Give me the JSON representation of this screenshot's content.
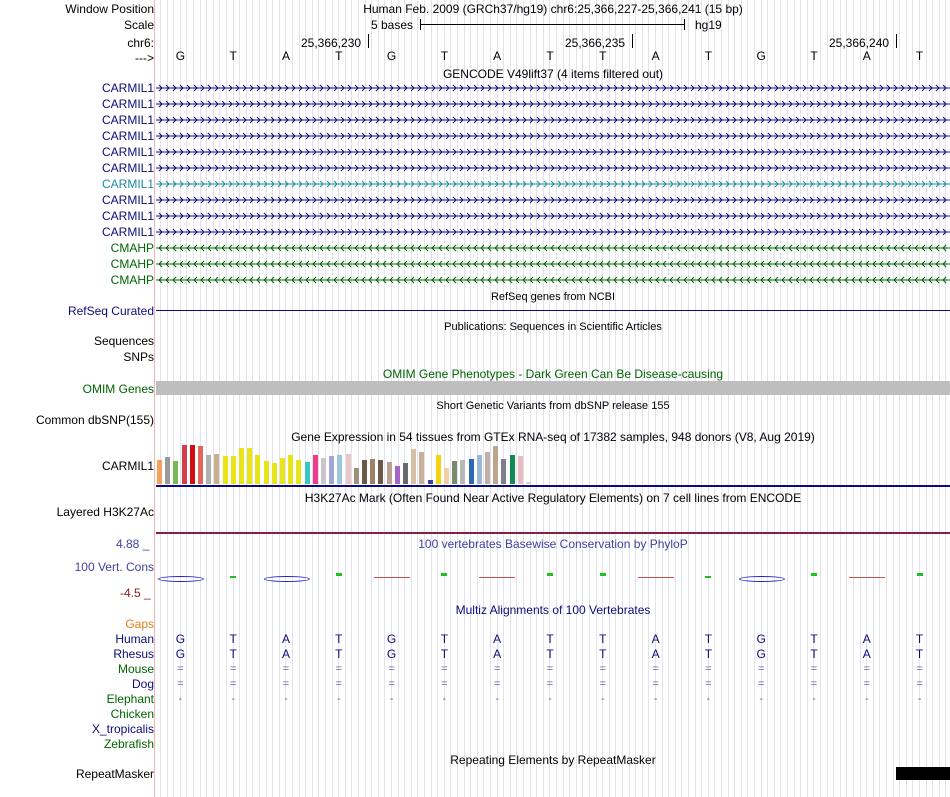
{
  "header": {
    "position_label": "Window Position",
    "position_value": "Human Feb. 2009 (GRCh37/hg19)   chr6:25,366,227-25,366,241 (15 bp)",
    "scale_label": "Scale",
    "scale_text": "5 bases",
    "scale_assembly": "hg19",
    "chrom_label": "chr6:",
    "coords": [
      "25,366,230",
      "25,366,235",
      "25,366,240"
    ],
    "strand_label": "--->",
    "bases": [
      "G",
      "T",
      "A",
      "T",
      "G",
      "T",
      "A",
      "T",
      "T",
      "A",
      "T",
      "G",
      "T",
      "A",
      "T"
    ]
  },
  "gencode": {
    "title": "GENCODE V49lift37 (4 items filtered out)",
    "genes": [
      {
        "label": "CARMIL1",
        "color": "#0c0c78",
        "strand": "+"
      },
      {
        "label": "CARMIL1",
        "color": "#0c0c78",
        "strand": "+"
      },
      {
        "label": "CARMIL1",
        "color": "#0c0c78",
        "strand": "+"
      },
      {
        "label": "CARMIL1",
        "color": "#0c0c78",
        "strand": "+"
      },
      {
        "label": "CARMIL1",
        "color": "#0c0c78",
        "strand": "+"
      },
      {
        "label": "CARMIL1",
        "color": "#0c0c78",
        "strand": "+"
      },
      {
        "label": "CARMIL1",
        "color": "#1a8ca0",
        "strand": "+"
      },
      {
        "label": "CARMIL1",
        "color": "#0c0c78",
        "strand": "+"
      },
      {
        "label": "CARMIL1",
        "color": "#0c0c78",
        "strand": "+"
      },
      {
        "label": "CARMIL1",
        "color": "#0c0c78",
        "strand": "+"
      },
      {
        "label": "CMAHP",
        "color": "#006400",
        "strand": "-"
      },
      {
        "label": "CMAHP",
        "color": "#006400",
        "strand": "-"
      },
      {
        "label": "CMAHP",
        "color": "#006400",
        "strand": "-"
      }
    ]
  },
  "refseq": {
    "title": "RefSeq genes from NCBI",
    "label": "RefSeq Curated"
  },
  "publications": {
    "title": "Publications: Sequences in Scientific Articles",
    "label1": "Sequences",
    "label2": "SNPs"
  },
  "omim": {
    "title": "OMIM Gene Phenotypes - Dark Green Can Be Disease-causing",
    "label": "OMIM Genes"
  },
  "dbsnp": {
    "title": "Short Genetic Variants from dbSNP release 155",
    "label": "Common dbSNP(155)"
  },
  "gtex": {
    "title": "Gene Expression in 54 tissues from GTEx RNA-seq of 17382 samples, 948 donors (V8, Aug 2019)",
    "label": "CARMIL1",
    "bars": [
      {
        "v": 0.6,
        "c": "#f2a25b"
      },
      {
        "v": 0.68,
        "c": "#9a9a9a"
      },
      {
        "v": 0.58,
        "c": "#7ab85a"
      },
      {
        "v": 0.98,
        "c": "#d23f4b"
      },
      {
        "v": 0.98,
        "c": "#d01010"
      },
      {
        "v": 0.96,
        "c": "#e0685c"
      },
      {
        "v": 0.72,
        "c": "#b0b0b0"
      },
      {
        "v": 0.74,
        "c": "#c8b08c"
      },
      {
        "v": 0.7,
        "c": "#e9e41a"
      },
      {
        "v": 0.7,
        "c": "#e9e41a"
      },
      {
        "v": 0.9,
        "c": "#e9e41a"
      },
      {
        "v": 0.9,
        "c": "#e9e41a"
      },
      {
        "v": 0.72,
        "c": "#e9e41a"
      },
      {
        "v": 0.58,
        "c": "#e9e41a"
      },
      {
        "v": 0.52,
        "c": "#e9e41a"
      },
      {
        "v": 0.64,
        "c": "#e9e41a"
      },
      {
        "v": 0.72,
        "c": "#e9e41a"
      },
      {
        "v": 0.6,
        "c": "#e9e41a"
      },
      {
        "v": 0.55,
        "c": "#3cc3c8"
      },
      {
        "v": 0.72,
        "c": "#ef3c8b"
      },
      {
        "v": 0.66,
        "c": "#c8c8c8"
      },
      {
        "v": 0.7,
        "c": "#a0a8d8"
      },
      {
        "v": 0.72,
        "c": "#9ec6e0"
      },
      {
        "v": 0.74,
        "c": "#ebc8c8"
      },
      {
        "v": 0.4,
        "c": "#a09078"
      },
      {
        "v": 0.6,
        "c": "#6a5a4a"
      },
      {
        "v": 0.62,
        "c": "#a08060"
      },
      {
        "v": 0.6,
        "c": "#6c5a46"
      },
      {
        "v": 0.56,
        "c": "#bea090"
      },
      {
        "v": 0.46,
        "c": "#a565c8"
      },
      {
        "v": 0.52,
        "c": "#6a6a6a"
      },
      {
        "v": 0.88,
        "c": "#d6c0a8"
      },
      {
        "v": 0.8,
        "c": "#c8b098"
      },
      {
        "v": 0.1,
        "c": "#4040a0"
      },
      {
        "v": 0.72,
        "c": "#f6d310"
      },
      {
        "v": 0.4,
        "c": "#f0d0a0"
      },
      {
        "v": 0.58,
        "c": "#7a8a6a"
      },
      {
        "v": 0.6,
        "c": "#b8b8b8"
      },
      {
        "v": 0.62,
        "c": "#2c6ab4"
      },
      {
        "v": 0.72,
        "c": "#9ab8d8"
      },
      {
        "v": 0.8,
        "c": "#c0b0a8"
      },
      {
        "v": 0.96,
        "c": "#bea48c"
      },
      {
        "v": 0.62,
        "c": "#80808c"
      },
      {
        "v": 0.72,
        "c": "#108a50"
      },
      {
        "v": 0.7,
        "c": "#e8bcc0"
      },
      {
        "v": 0.06,
        "c": "#e0c8d0"
      }
    ]
  },
  "h3k27ac": {
    "title": "H3K27Ac Mark (Often Found Near Active Regulatory Elements) on 7 cell lines from ENCODE",
    "label": "Layered H3K27Ac"
  },
  "phylop": {
    "title": "100 vertebrates Basewise Conservation by PhyloP",
    "label": "100 Vert. Cons",
    "max": "4.88 _",
    "min": "-4.5 _",
    "scores": [
      -0.6,
      0.15,
      -0.5,
      0.9,
      0,
      0.8,
      -0.1,
      0.8,
      0.9,
      -0.1,
      0.15,
      -0.6,
      0.9,
      -0.1,
      0.9
    ]
  },
  "multiz": {
    "title": "Multiz Alignments of 100 Vertebrates",
    "species": [
      {
        "label": "Gaps",
        "color": "#e08020",
        "row": ""
      },
      {
        "label": "Human",
        "color": "#0c0c78",
        "row": "GTATGTATTATGTAT"
      },
      {
        "label": "Rhesus",
        "color": "#0c0c78",
        "row": "GTATGTATTATGTAT"
      },
      {
        "label": "Mouse",
        "color": "#006400",
        "row": "==============="
      },
      {
        "label": "Dog",
        "color": "#0c0c78",
        "row": "==============="
      },
      {
        "label": "Elephant",
        "color": "#006400",
        "row": "---------------"
      },
      {
        "label": "Chicken",
        "color": "#006400",
        "row": ""
      },
      {
        "label": "X_tropicalis",
        "color": "#0c0c78",
        "row": ""
      },
      {
        "label": "Zebrafish",
        "color": "#006400",
        "row": ""
      }
    ]
  },
  "rmsk": {
    "title": "Repeating Elements by RepeatMasker",
    "label": "RepeatMasker"
  }
}
